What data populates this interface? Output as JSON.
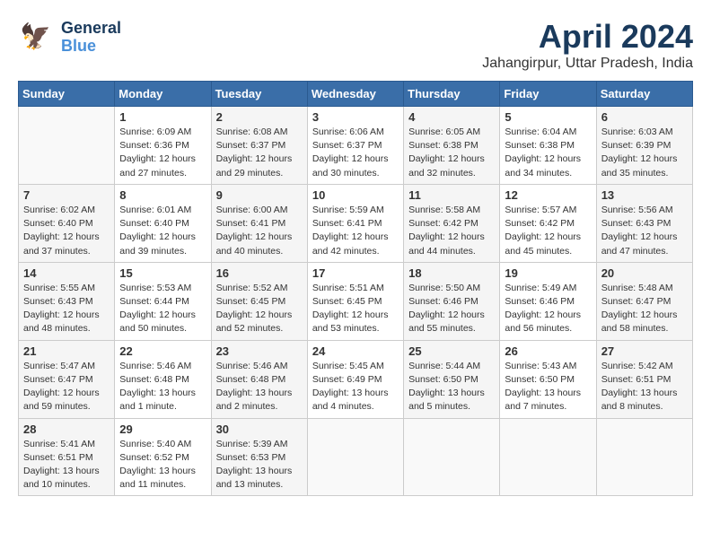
{
  "header": {
    "logo_general": "General",
    "logo_blue": "Blue",
    "month_title": "April 2024",
    "location": "Jahangirpur, Uttar Pradesh, India"
  },
  "weekdays": [
    "Sunday",
    "Monday",
    "Tuesday",
    "Wednesday",
    "Thursday",
    "Friday",
    "Saturday"
  ],
  "weeks": [
    [
      {
        "day": "",
        "info": ""
      },
      {
        "day": "1",
        "info": "Sunrise: 6:09 AM\nSunset: 6:36 PM\nDaylight: 12 hours\nand 27 minutes."
      },
      {
        "day": "2",
        "info": "Sunrise: 6:08 AM\nSunset: 6:37 PM\nDaylight: 12 hours\nand 29 minutes."
      },
      {
        "day": "3",
        "info": "Sunrise: 6:06 AM\nSunset: 6:37 PM\nDaylight: 12 hours\nand 30 minutes."
      },
      {
        "day": "4",
        "info": "Sunrise: 6:05 AM\nSunset: 6:38 PM\nDaylight: 12 hours\nand 32 minutes."
      },
      {
        "day": "5",
        "info": "Sunrise: 6:04 AM\nSunset: 6:38 PM\nDaylight: 12 hours\nand 34 minutes."
      },
      {
        "day": "6",
        "info": "Sunrise: 6:03 AM\nSunset: 6:39 PM\nDaylight: 12 hours\nand 35 minutes."
      }
    ],
    [
      {
        "day": "7",
        "info": "Sunrise: 6:02 AM\nSunset: 6:40 PM\nDaylight: 12 hours\nand 37 minutes."
      },
      {
        "day": "8",
        "info": "Sunrise: 6:01 AM\nSunset: 6:40 PM\nDaylight: 12 hours\nand 39 minutes."
      },
      {
        "day": "9",
        "info": "Sunrise: 6:00 AM\nSunset: 6:41 PM\nDaylight: 12 hours\nand 40 minutes."
      },
      {
        "day": "10",
        "info": "Sunrise: 5:59 AM\nSunset: 6:41 PM\nDaylight: 12 hours\nand 42 minutes."
      },
      {
        "day": "11",
        "info": "Sunrise: 5:58 AM\nSunset: 6:42 PM\nDaylight: 12 hours\nand 44 minutes."
      },
      {
        "day": "12",
        "info": "Sunrise: 5:57 AM\nSunset: 6:42 PM\nDaylight: 12 hours\nand 45 minutes."
      },
      {
        "day": "13",
        "info": "Sunrise: 5:56 AM\nSunset: 6:43 PM\nDaylight: 12 hours\nand 47 minutes."
      }
    ],
    [
      {
        "day": "14",
        "info": "Sunrise: 5:55 AM\nSunset: 6:43 PM\nDaylight: 12 hours\nand 48 minutes."
      },
      {
        "day": "15",
        "info": "Sunrise: 5:53 AM\nSunset: 6:44 PM\nDaylight: 12 hours\nand 50 minutes."
      },
      {
        "day": "16",
        "info": "Sunrise: 5:52 AM\nSunset: 6:45 PM\nDaylight: 12 hours\nand 52 minutes."
      },
      {
        "day": "17",
        "info": "Sunrise: 5:51 AM\nSunset: 6:45 PM\nDaylight: 12 hours\nand 53 minutes."
      },
      {
        "day": "18",
        "info": "Sunrise: 5:50 AM\nSunset: 6:46 PM\nDaylight: 12 hours\nand 55 minutes."
      },
      {
        "day": "19",
        "info": "Sunrise: 5:49 AM\nSunset: 6:46 PM\nDaylight: 12 hours\nand 56 minutes."
      },
      {
        "day": "20",
        "info": "Sunrise: 5:48 AM\nSunset: 6:47 PM\nDaylight: 12 hours\nand 58 minutes."
      }
    ],
    [
      {
        "day": "21",
        "info": "Sunrise: 5:47 AM\nSunset: 6:47 PM\nDaylight: 12 hours\nand 59 minutes."
      },
      {
        "day": "22",
        "info": "Sunrise: 5:46 AM\nSunset: 6:48 PM\nDaylight: 13 hours\nand 1 minute."
      },
      {
        "day": "23",
        "info": "Sunrise: 5:46 AM\nSunset: 6:48 PM\nDaylight: 13 hours\nand 2 minutes."
      },
      {
        "day": "24",
        "info": "Sunrise: 5:45 AM\nSunset: 6:49 PM\nDaylight: 13 hours\nand 4 minutes."
      },
      {
        "day": "25",
        "info": "Sunrise: 5:44 AM\nSunset: 6:50 PM\nDaylight: 13 hours\nand 5 minutes."
      },
      {
        "day": "26",
        "info": "Sunrise: 5:43 AM\nSunset: 6:50 PM\nDaylight: 13 hours\nand 7 minutes."
      },
      {
        "day": "27",
        "info": "Sunrise: 5:42 AM\nSunset: 6:51 PM\nDaylight: 13 hours\nand 8 minutes."
      }
    ],
    [
      {
        "day": "28",
        "info": "Sunrise: 5:41 AM\nSunset: 6:51 PM\nDaylight: 13 hours\nand 10 minutes."
      },
      {
        "day": "29",
        "info": "Sunrise: 5:40 AM\nSunset: 6:52 PM\nDaylight: 13 hours\nand 11 minutes."
      },
      {
        "day": "30",
        "info": "Sunrise: 5:39 AM\nSunset: 6:53 PM\nDaylight: 13 hours\nand 13 minutes."
      },
      {
        "day": "",
        "info": ""
      },
      {
        "day": "",
        "info": ""
      },
      {
        "day": "",
        "info": ""
      },
      {
        "day": "",
        "info": ""
      }
    ]
  ]
}
